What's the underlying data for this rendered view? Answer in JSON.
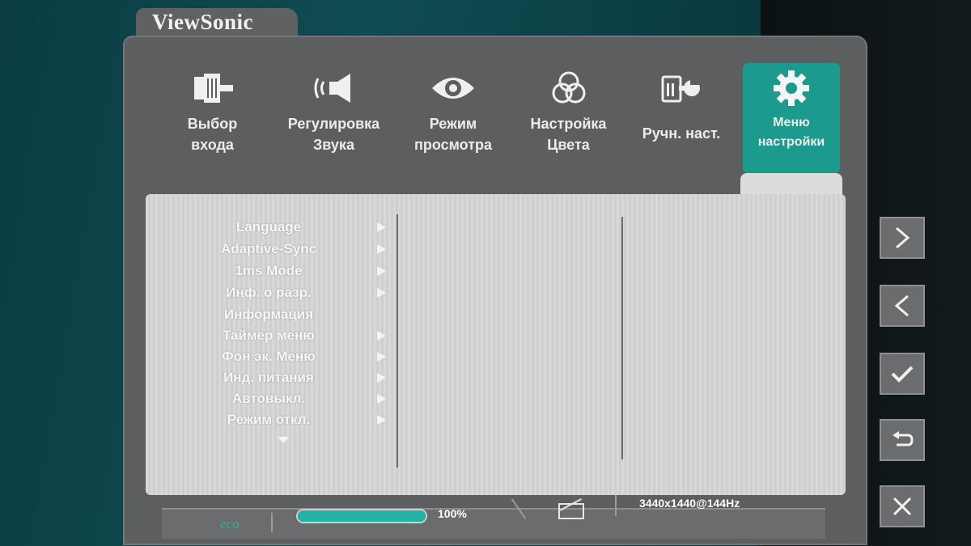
{
  "brand": "ViewSonic",
  "menu": [
    {
      "icon": "input-plug-icon",
      "label": "Выбор\nвхода",
      "active": false
    },
    {
      "icon": "speaker-sound-icon",
      "label": "Регулировка\nЗвука",
      "active": false
    },
    {
      "icon": "eye-icon",
      "label": "Режим\nпросмотра",
      "active": false
    },
    {
      "icon": "color-circles-icon",
      "label": "Настройка\nЦвета",
      "active": false
    },
    {
      "icon": "manual-wrench-icon",
      "label": "Ручн. наст.",
      "active": false
    },
    {
      "icon": "gear-icon",
      "label": "Меню\nнастройки",
      "active": true
    }
  ],
  "settings_list": [
    {
      "label": "Language",
      "has_arrow": true
    },
    {
      "label": "Adaptive-Sync",
      "has_arrow": true
    },
    {
      "label": "1ms Mode",
      "has_arrow": true
    },
    {
      "label": "Инф. о разр.",
      "has_arrow": true
    },
    {
      "label": "Информация",
      "has_arrow": false
    },
    {
      "label": "Таймер меню",
      "has_arrow": true
    },
    {
      "label": "Фон эк. Меню",
      "has_arrow": true
    },
    {
      "label": "Инд. питания",
      "has_arrow": true
    },
    {
      "label": "Автовыкл.",
      "has_arrow": true
    },
    {
      "label": "Режим откл.",
      "has_arrow": true
    }
  ],
  "status": {
    "eco_label": "eco",
    "progress_percent": 100,
    "progress_text": "100%",
    "resolution": "3440x1440@144Hz"
  },
  "side_buttons": [
    {
      "name": "next-button",
      "icon": "chevron-right-icon"
    },
    {
      "name": "previous-button",
      "icon": "chevron-left-icon"
    },
    {
      "name": "confirm-button",
      "icon": "checkmark-icon"
    },
    {
      "name": "back-button",
      "icon": "return-arrow-icon"
    },
    {
      "name": "close-button",
      "icon": "close-icon"
    }
  ],
  "colors": {
    "accent": "#1d9a8e",
    "osd_frame": "#5c5e60",
    "panel": "#d8d8d8",
    "progress_fill": "#22b3a5"
  }
}
